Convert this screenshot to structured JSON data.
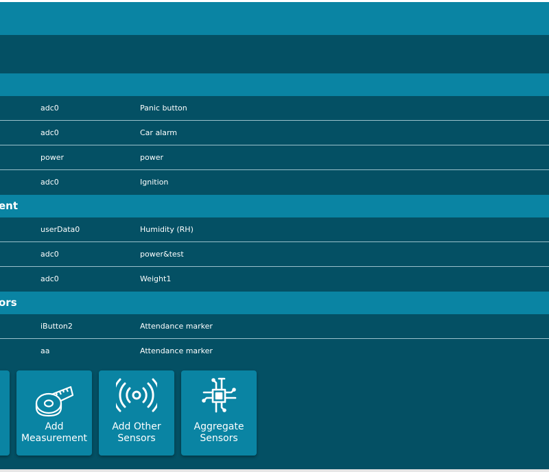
{
  "sections": [
    {
      "title": "",
      "rows": [
        {
          "source": "adc0",
          "name": "Panic button"
        },
        {
          "source": "adc0",
          "name": "Car alarm"
        },
        {
          "source": "power",
          "name": "power"
        },
        {
          "source": "adc0",
          "name": "Ignition"
        }
      ]
    },
    {
      "title": "ent",
      "rows": [
        {
          "source": "userData0",
          "name": "Humidity (RH)"
        },
        {
          "source": "adc0",
          "name": "power&test"
        },
        {
          "source": "adc0",
          "name": "Weight1"
        }
      ]
    },
    {
      "title": "ors",
      "rows": [
        {
          "source": "iButton2",
          "name": "Attendance marker"
        },
        {
          "source": "aa",
          "name": "Attendance marker"
        }
      ]
    }
  ],
  "tiles": {
    "measurement": {
      "line1": "Add",
      "line2": "Measurement",
      "icon": "tape-measure-icon"
    },
    "other": {
      "line1": "Add Other",
      "line2": "Sensors",
      "icon": "signal-waves-icon"
    },
    "aggregate": {
      "line1": "Aggregate",
      "line2": "Sensors",
      "icon": "chip-icon"
    }
  },
  "colors": {
    "header": "#0a84a3",
    "panel": "#045064",
    "divider": "#9cc2cc"
  }
}
